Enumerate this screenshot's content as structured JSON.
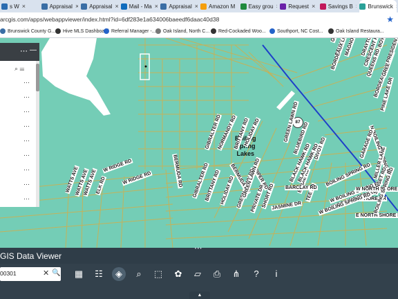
{
  "browser": {
    "tabs": [
      {
        "label": "s W",
        "color": "#2b6cb0"
      },
      {
        "label": "Appraisal",
        "color": "#3a6ea5"
      },
      {
        "label": "Appraisal",
        "color": "#3a6ea5"
      },
      {
        "label": "Mail - Ma",
        "color": "#0f6cbd"
      },
      {
        "label": "Appraisal",
        "color": "#3a6ea5"
      },
      {
        "label": "Amazon M",
        "color": "#f59e0b"
      },
      {
        "label": "Easy grou",
        "color": "#1f8a3d"
      },
      {
        "label": "Request",
        "color": "#6b21a8"
      },
      {
        "label": "Savings B",
        "color": "#c2185b"
      },
      {
        "label": "Brunswick",
        "color": "#2aa198",
        "active": true
      }
    ],
    "url": "arcgis.com/apps/webappviewer/index.html?id=6df283e1a634006baeedf6daac40d38",
    "bookmarks": [
      {
        "label": "Brunswick County G...",
        "color": "#3a6ea5"
      },
      {
        "label": "Hive MLS Dashboard",
        "color": "#333333"
      },
      {
        "label": "Referral Manager -...",
        "color": "#2563c9"
      },
      {
        "label": "Oak Island, North C...",
        "color": "#777777"
      },
      {
        "label": "Red-Cockaded Woo...",
        "color": "#333333"
      },
      {
        "label": "Southport, NC Cost...",
        "color": "#2563c9"
      },
      {
        "label": "Oak Island Restaura...",
        "color": "#333333"
      }
    ]
  },
  "map": {
    "place_label": [
      "Boiling",
      "Spring",
      "Lakes"
    ],
    "route_shield": "87",
    "street_labels": [
      "GREEN LAWN RD",
      "BLUEBIRD RD",
      "BIRDIE RD",
      "TEE RD",
      "GREEN LAWN RD",
      "DIVOT RD",
      "BLACK HAWK RD",
      "BLACK HAWK RD",
      "BARCLAY RD",
      "JASMINE DR",
      "W BOILING SPRING RD",
      "PINE LAKE DR",
      "N BOILING SPRING RD",
      "W BOILING SPRING RD",
      "BERMUDA RD",
      "GIBRALTER RD",
      "NORMANDY RD",
      "BRITTANY RD",
      "HOLIDAY RD",
      "BERMUDA RD",
      "PIPER RD",
      "W RIDGE RD",
      "GIBRALTER RD",
      "BRITTANY RD",
      "HOLIDAY RD",
      "W RIDGE RD",
      "WATTS AVE",
      "WATTS AVE",
      "WATTS AVE",
      "ELK RD",
      "GARAGE RD",
      "SUNSET RD",
      "W NORTH SHORE DR",
      "MILLER LANE",
      "N SHORE DR",
      "BOILING SPRING RD",
      "GREEN LAWN RD",
      "SHORT RD",
      "PRIVATE DR",
      "E NORTH SHORE DR",
      "BOILING SPRING RD",
      "W BOILING SPRING RD",
      "GANNETT DR",
      "PENNY DR",
      "MAGNOLIA RD",
      "BORDEAUX LN",
      "DRAYTON RD",
      "CRESCENT RD",
      "QUEENS RD",
      "BORDEAUX LN",
      "GREEN RD",
      "BOYD RD",
      "PRESIDENT RD"
    ]
  },
  "panel": {
    "more_label": "⋯",
    "minimize_label": "—",
    "row_count_label": "⋯"
  },
  "app": {
    "title": "GIS Data Viewer",
    "search_value": "00301",
    "toolbar_icons": [
      "grid-icon",
      "list-icon",
      "layers-icon",
      "zoom-search-icon",
      "select-icon",
      "palette-icon",
      "measure-icon",
      "print-icon",
      "share-icon",
      "help-icon",
      "info-icon"
    ],
    "bottom_tab": "▲"
  },
  "colors": {
    "map_bg": "#74cdb6",
    "road": "#c4b25a",
    "highway": "#1e40c8",
    "toolbar": "#33414c"
  }
}
